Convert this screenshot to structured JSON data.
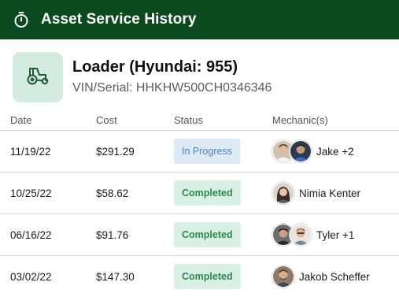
{
  "header": {
    "title": "Asset Service History",
    "icon": "stopwatch-icon"
  },
  "asset": {
    "name": "Loader (Hyundai: 955)",
    "serial": "VIN/Serial: HHKHW500CH0346346",
    "icon": "tractor-icon"
  },
  "table": {
    "columns": [
      "Date",
      "Cost",
      "Status",
      "Mechanic(s)"
    ],
    "rows": [
      {
        "date": "11/19/22",
        "cost": "$291.29",
        "status": "In Progress",
        "mechanic": "Jake +2"
      },
      {
        "date": "10/25/22",
        "cost": "$58.62",
        "status": "Completed",
        "mechanic": "Nimia Kenter"
      },
      {
        "date": "06/16/22",
        "cost": "$91.76",
        "status": "Completed",
        "mechanic": "Tyler +1"
      },
      {
        "date": "03/02/22",
        "cost": "$147.30",
        "status": "Completed",
        "mechanic": "Jakob Scheffer"
      }
    ]
  },
  "colors": {
    "header_bg": "#0b4a1f",
    "asset_tile_bg": "#d3ecdf",
    "in_progress_bg": "#dde9f5",
    "in_progress_text": "#4b83b9",
    "completed_bg": "#d9f1e4",
    "completed_text": "#2d8a4c"
  }
}
